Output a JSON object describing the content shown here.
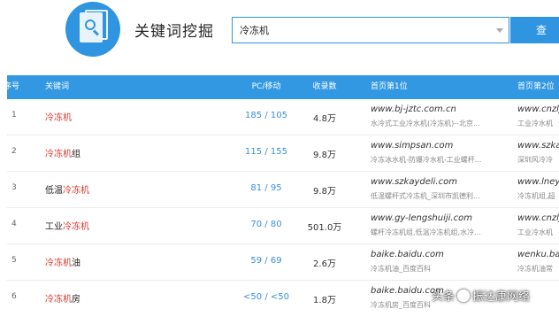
{
  "header": {
    "title": "关键词挖掘",
    "search_value": "冷冻机",
    "search_button": "查 询"
  },
  "table": {
    "columns": [
      "序号",
      "关键词",
      "PC/移动",
      "收录数",
      "首页第1位",
      "首页第2位"
    ],
    "rows": [
      {
        "idx": "1",
        "kw_pre": "",
        "kw_hl": "冷冻机",
        "kw_post": "",
        "pc": "185 / 105",
        "count": "4.8万",
        "url1": "www.bj-jztc.com.cn",
        "desc1": "水冷式工业冷水机(冷冻机)--北京...",
        "url2": "www.cnzlj",
        "desc2": "工业冷水机"
      },
      {
        "idx": "2",
        "kw_pre": "",
        "kw_hl": "冷冻机",
        "kw_post": "组",
        "pc": "115 / 155",
        "count": "9.8万",
        "url1": "www.simpsan.com",
        "desc1": "冷冻冰水机-防爆冷水机-工业螺杆...",
        "url2": "www.szka",
        "desc2": "深圳风冷冷"
      },
      {
        "idx": "3",
        "kw_pre": "低温",
        "kw_hl": "冷冻机",
        "kw_post": "",
        "pc": "81 / 95",
        "count": "9.8万",
        "url1": "www.szkaydeli.com",
        "desc1": "低温螺杆式冷冻机_深圳市凯德利...",
        "url2": "www.lney",
        "desc2": "冷冻机组,超"
      },
      {
        "idx": "4",
        "kw_pre": "工业",
        "kw_hl": "冷冻机",
        "kw_post": "",
        "pc": "70 / 80",
        "count": "501.0万",
        "url1": "www.gy-lengshuiji.com",
        "desc1": "螺杆冷冻机组,低温冷冻机组,水冷...",
        "url2": "www.cnzlj",
        "desc2": "工业冷水机"
      },
      {
        "idx": "5",
        "kw_pre": "",
        "kw_hl": "冷冻机",
        "kw_post": "油",
        "pc": "59 / 69",
        "count": "2.6万",
        "url1": "baike.baidu.com",
        "desc1": "冷冻机油_百度百科",
        "url2": "wenku.bai",
        "desc2": "冷冻机油常"
      },
      {
        "idx": "6",
        "kw_pre": "",
        "kw_hl": "冷冻机",
        "kw_post": "房",
        "pc": "<50 / <50",
        "count": "1.8万",
        "url1": "baike.baidu.com",
        "desc1": "冷冻机房_百度百科",
        "url2": "",
        "desc2": ""
      }
    ]
  },
  "watermark": {
    "prefix": "头条",
    "suffix": "振达康网络"
  }
}
